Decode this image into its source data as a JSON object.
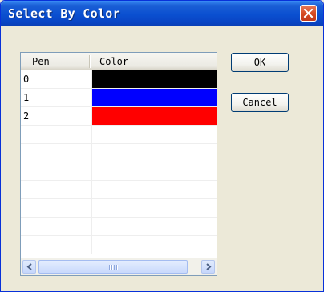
{
  "window": {
    "title": "Select By Color"
  },
  "list": {
    "columns": [
      "Pen",
      "Color"
    ],
    "rows": [
      {
        "pen": "0",
        "color": "#000000"
      },
      {
        "pen": "1",
        "color": "#0000ff"
      },
      {
        "pen": "2",
        "color": "#ff0000"
      },
      {
        "pen": "",
        "color": ""
      },
      {
        "pen": "",
        "color": ""
      },
      {
        "pen": "",
        "color": ""
      },
      {
        "pen": "",
        "color": ""
      },
      {
        "pen": "",
        "color": ""
      },
      {
        "pen": "",
        "color": ""
      },
      {
        "pen": "",
        "color": ""
      }
    ]
  },
  "buttons": {
    "ok": "OK",
    "cancel": "Cancel"
  }
}
